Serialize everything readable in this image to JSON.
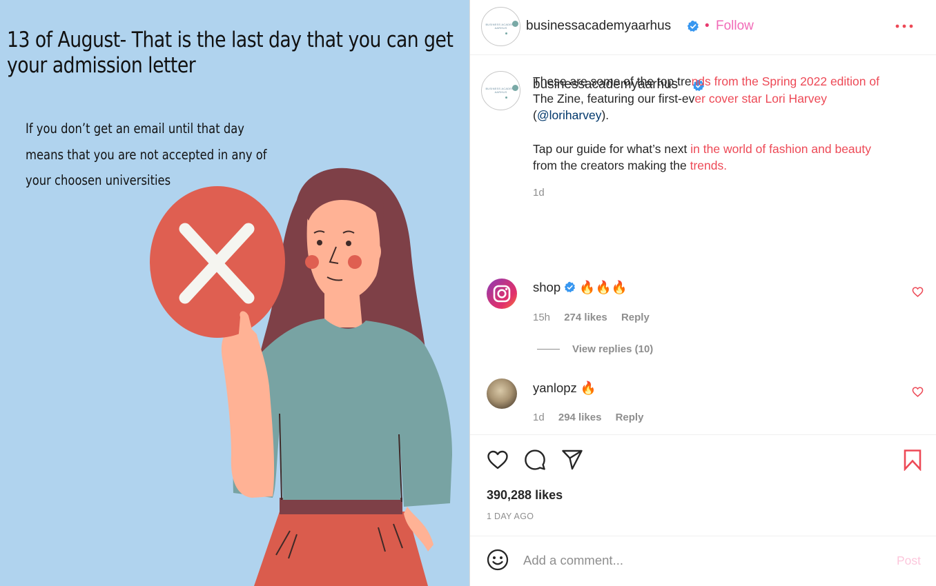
{
  "image": {
    "headline_lines": [
      "13 of August- That is the last day that you can get",
      "your admission letter"
    ],
    "subtext_lines": [
      "If you don’t get an email until that day",
      "means that you are not accepted in any of",
      "your choosen universities"
    ],
    "colors": {
      "background": "#b0d3ee",
      "sign": "#df5f51",
      "hair": "#7e4047",
      "shirt": "#78a3a3",
      "skirt": "#da5c4d",
      "skin": "#ffb295"
    }
  },
  "header": {
    "logo_text": "BUSINESS ACADEMY AARHUS",
    "username": "businessacademyaarhus",
    "verified_icon": "verified-badge-icon",
    "separator": "•",
    "follow_label": "Follow",
    "more_icon": "more-options-icon"
  },
  "caption": {
    "logo_text": "BUSINESS ACADEMY AARHUS",
    "username": "businessacademyaarhus",
    "p1_a": "These are some of the top tre",
    "p1_b": "nds from the Spring 2022 edition of",
    "p1_c": "The Zine, featuring our first-ev",
    "p1_d": "er cover star Lori Harvey",
    "p1_e": "(",
    "p1_f": "@loriharvey",
    "p1_g": ").",
    "p2_a": "Tap our guide for what’s next ",
    "p2_b": "in the world of fashion and beauty",
    "p2_c": "from the creators making the ",
    "p2_d": "trends.",
    "time": "1d"
  },
  "comments": [
    {
      "username": "shop",
      "text": "🔥🔥🔥",
      "time": "15h",
      "likes": "274 likes",
      "reply": "Reply",
      "verified": true
    },
    {
      "username": "yanlopz",
      "text": "🔥",
      "time": "1d",
      "likes": "294 likes",
      "reply": "Reply",
      "verified": false
    }
  ],
  "view_replies": "View replies (10)",
  "actions": {
    "like_icon": "heart-icon",
    "comment_icon": "comment-icon",
    "share_icon": "share-icon",
    "save_icon": "bookmark-icon",
    "likes_count": "390,288 likes",
    "post_time": "1 DAY AGO"
  },
  "comment_bar": {
    "placeholder": "Add a comment...",
    "post_label": "Post",
    "emoji_icon": "emoji-icon"
  },
  "accent_colors": {
    "red": "#ed4956",
    "follow_pink": "#f16ab7",
    "verified_blue": "#3897f0",
    "link": "#00376b"
  }
}
